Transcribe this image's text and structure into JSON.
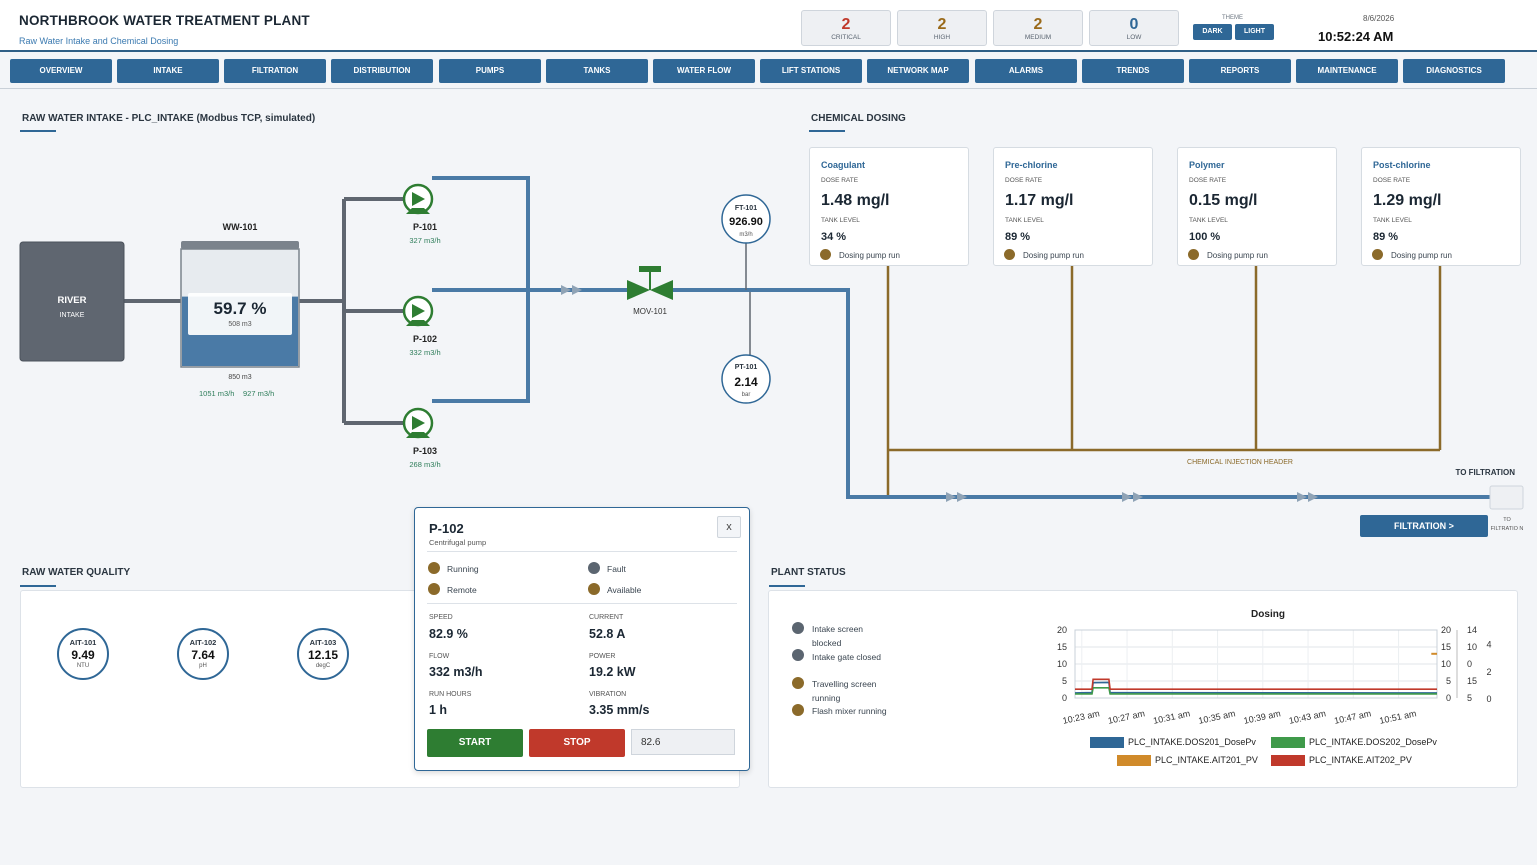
{
  "header": {
    "title": "NORTHBROOK WATER TREATMENT PLANT",
    "subtitle": "Raw Water Intake and Chemical Dosing",
    "alarms": [
      {
        "count": "2",
        "label": "CRITICAL",
        "color": "#c0392b"
      },
      {
        "count": "2",
        "label": "HIGH",
        "color": "#9a6a1a"
      },
      {
        "count": "2",
        "label": "MEDIUM",
        "color": "#9a6a1a"
      },
      {
        "count": "0",
        "label": "LOW",
        "color": "#2f6796"
      }
    ],
    "theme_label": "THEME",
    "theme_dark": "DARK",
    "theme_light": "LIGHT",
    "date": "8/6/2026",
    "time": "10:52:24 AM"
  },
  "nav": [
    "OVERVIEW",
    "INTAKE",
    "FILTRATION",
    "DISTRIBUTION",
    "PUMPS",
    "TANKS",
    "WATER FLOW",
    "LIFT STATIONS",
    "NETWORK MAP",
    "ALARMS",
    "TRENDS",
    "REPORTS",
    "MAINTENANCE",
    "DIAGNOSTICS"
  ],
  "intake": {
    "title": "RAW WATER INTAKE  -  PLC_INTAKE (Modbus TCP, simulated)",
    "river_label": "RIVER",
    "river_sub": "INTAKE",
    "tank_name": "WW-101",
    "tank_level": "59.7 %",
    "tank_level_value": 59.7,
    "tank_volume": "508 m3",
    "tank_capacity": "850 m3",
    "flow_in": "1051 m3/h",
    "flow_out": "927 m3/h",
    "pumps": [
      {
        "name": "P-101",
        "flow": "327 m3/h"
      },
      {
        "name": "P-102",
        "flow": "332 m3/h"
      },
      {
        "name": "P-103",
        "flow": "268 m3/h"
      }
    ],
    "valve": "MOV-101",
    "ft": {
      "tag": "FT-101",
      "value": "926.90",
      "unit": "m3/h"
    },
    "pt": {
      "tag": "PT-101",
      "value": "2.14",
      "unit": "bar"
    },
    "injection_header": "CHEMICAL INJECTION HEADER",
    "to_filtration": "TO FILTRATION",
    "to_filtration_small": "TO FILTRATIO N",
    "filtration_button": "FILTRATION >"
  },
  "dosing": {
    "title": "CHEMICAL DOSING",
    "dose_rate_label": "DOSE RATE",
    "tank_level_label": "TANK LEVEL",
    "cards": [
      {
        "name": "Coagulant",
        "dose": "1.48 mg/l",
        "tank": "34 %",
        "status": "Dosing pump run"
      },
      {
        "name": "Pre-chlorine",
        "dose": "1.17 mg/l",
        "tank": "89 %",
        "status": "Dosing pump run"
      },
      {
        "name": "Polymer",
        "dose": "0.15 mg/l",
        "tank": "100 %",
        "status": "Dosing pump run"
      },
      {
        "name": "Post-chlorine",
        "dose": "1.29 mg/l",
        "tank": "89 %",
        "status": "Dosing pump run"
      }
    ]
  },
  "quality": {
    "title": "RAW WATER QUALITY",
    "gauges": [
      {
        "tag": "AIT-101",
        "value": "9.49",
        "unit": "NTU"
      },
      {
        "tag": "AIT-102",
        "value": "7.64",
        "unit": "pH"
      },
      {
        "tag": "AIT-103",
        "value": "12.15",
        "unit": "degC"
      }
    ]
  },
  "popup": {
    "title": "P-102",
    "subtitle": "Centrifugal pump",
    "close": "x",
    "status": [
      {
        "label": "Running",
        "color": "#8b6a2a"
      },
      {
        "label": "Fault",
        "color": "#5b6570"
      },
      {
        "label": "Remote",
        "color": "#8b6a2a"
      },
      {
        "label": "Available",
        "color": "#8b6a2a"
      }
    ],
    "metrics": [
      {
        "label": "SPEED",
        "value": "82.9 %"
      },
      {
        "label": "CURRENT",
        "value": "52.8 A"
      },
      {
        "label": "FLOW",
        "value": "332 m3/h"
      },
      {
        "label": "POWER",
        "value": "19.2 kW"
      },
      {
        "label": "RUN HOURS",
        "value": "1 h"
      },
      {
        "label": "VIBRATION",
        "value": "3.35 mm/s"
      }
    ],
    "start": "START",
    "stop": "STOP",
    "setpoint": "82.6"
  },
  "plant_status": {
    "title": "PLANT STATUS",
    "items": [
      {
        "label": "Intake screen blocked",
        "color": "#5b6570"
      },
      {
        "label": "Intake gate closed",
        "color": "#5b6570"
      },
      {
        "label": "Travelling screen running",
        "color": "#8b6a2a"
      },
      {
        "label": "Flash mixer running",
        "color": "#8b6a2a"
      }
    ]
  },
  "chart_data": {
    "type": "line",
    "title": "Dosing",
    "x_ticks": [
      "10:23 am",
      "10:27 am",
      "10:31 am",
      "10:35 am",
      "10:39 am",
      "10:43 am",
      "10:47 am",
      "10:51 am"
    ],
    "y_left_ticks": [
      "0",
      "5",
      "10",
      "15",
      "20"
    ],
    "y_right1_ticks": [
      "0",
      "5",
      "10",
      "15",
      "20"
    ],
    "y_right2_ticks": [
      "0",
      "2",
      "4"
    ],
    "ylim": [
      0,
      20
    ],
    "grid": true,
    "legend_position": "bottom",
    "series": [
      {
        "name": "PLC_INTAKE.DOS201_DosePv",
        "color": "#2f6796",
        "axis": "left",
        "x": [
          0,
          1.5,
          1.6,
          3.0,
          3.1,
          32
        ],
        "y": [
          1.5,
          1.6,
          4.5,
          4.6,
          1.6,
          1.5
        ]
      },
      {
        "name": "PLC_INTAKE.DOS202_DosePv",
        "color": "#3f9a4a",
        "axis": "left",
        "x": [
          0,
          1.5,
          1.6,
          3.0,
          3.1,
          32
        ],
        "y": [
          1.2,
          1.2,
          3.0,
          3.0,
          1.2,
          1.2
        ]
      },
      {
        "name": "PLC_INTAKE.AIT201_PV",
        "color": "#d08a2a",
        "axis": "right2",
        "x": [
          31.5,
          32
        ],
        "y": [
          2.6,
          2.6
        ]
      },
      {
        "name": "PLC_INTAKE.AIT202_PV",
        "color": "#c0392b",
        "axis": "left",
        "x": [
          0,
          1.5,
          1.6,
          3.0,
          3.1,
          32
        ],
        "y": [
          2.6,
          2.6,
          5.5,
          5.5,
          2.6,
          2.6
        ]
      }
    ]
  },
  "colors": {
    "water": "#4a7aa6",
    "pipe_grey": "#5f6670",
    "chemical": "#8b6a2a",
    "pump_green": "#2e7d32",
    "accent": "#2f6796",
    "start": "#2e7d32",
    "stop": "#c0392b"
  }
}
